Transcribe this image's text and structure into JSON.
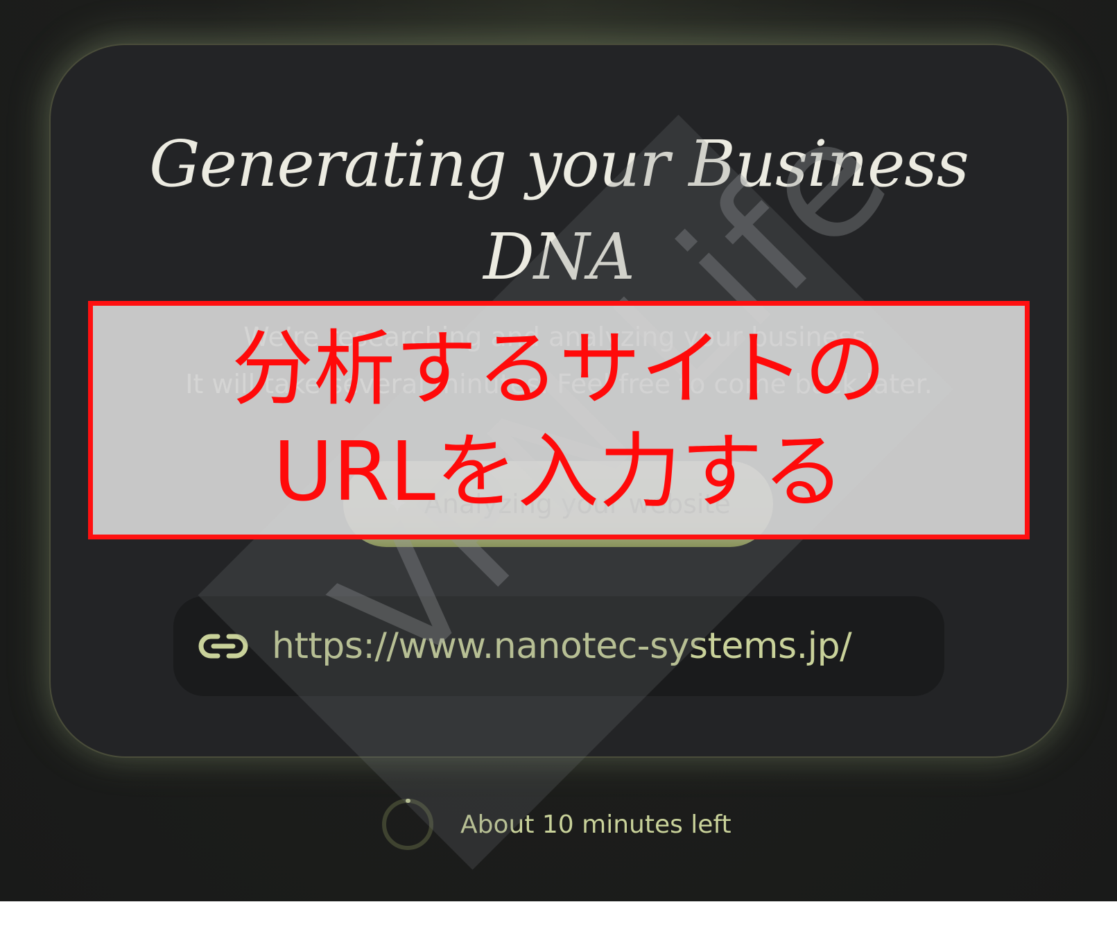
{
  "card": {
    "title_line1": "Generating your Business",
    "title_line2": "DNA",
    "subtitle_line1": "We’re researching and analyzing your business.",
    "subtitle_line2": "It will take several minutes. Feel free to come back later.",
    "analyze_button": {
      "icon": "sparkle-icon",
      "label": "Analyzing your website"
    },
    "url_field": {
      "icon": "link-icon",
      "value": "https://www.nanotec-systems.jp/"
    }
  },
  "status": {
    "icon": "spinner-icon",
    "text": "About 10 minutes left"
  },
  "watermark": {
    "text": "VPN Life"
  },
  "annotation": {
    "line1": "分析するサイトの",
    "line2": "URLを入力する"
  },
  "colors": {
    "accent": "#c9d29a",
    "card_bg": "#232426",
    "annotation_red": "#ff0a0a"
  }
}
